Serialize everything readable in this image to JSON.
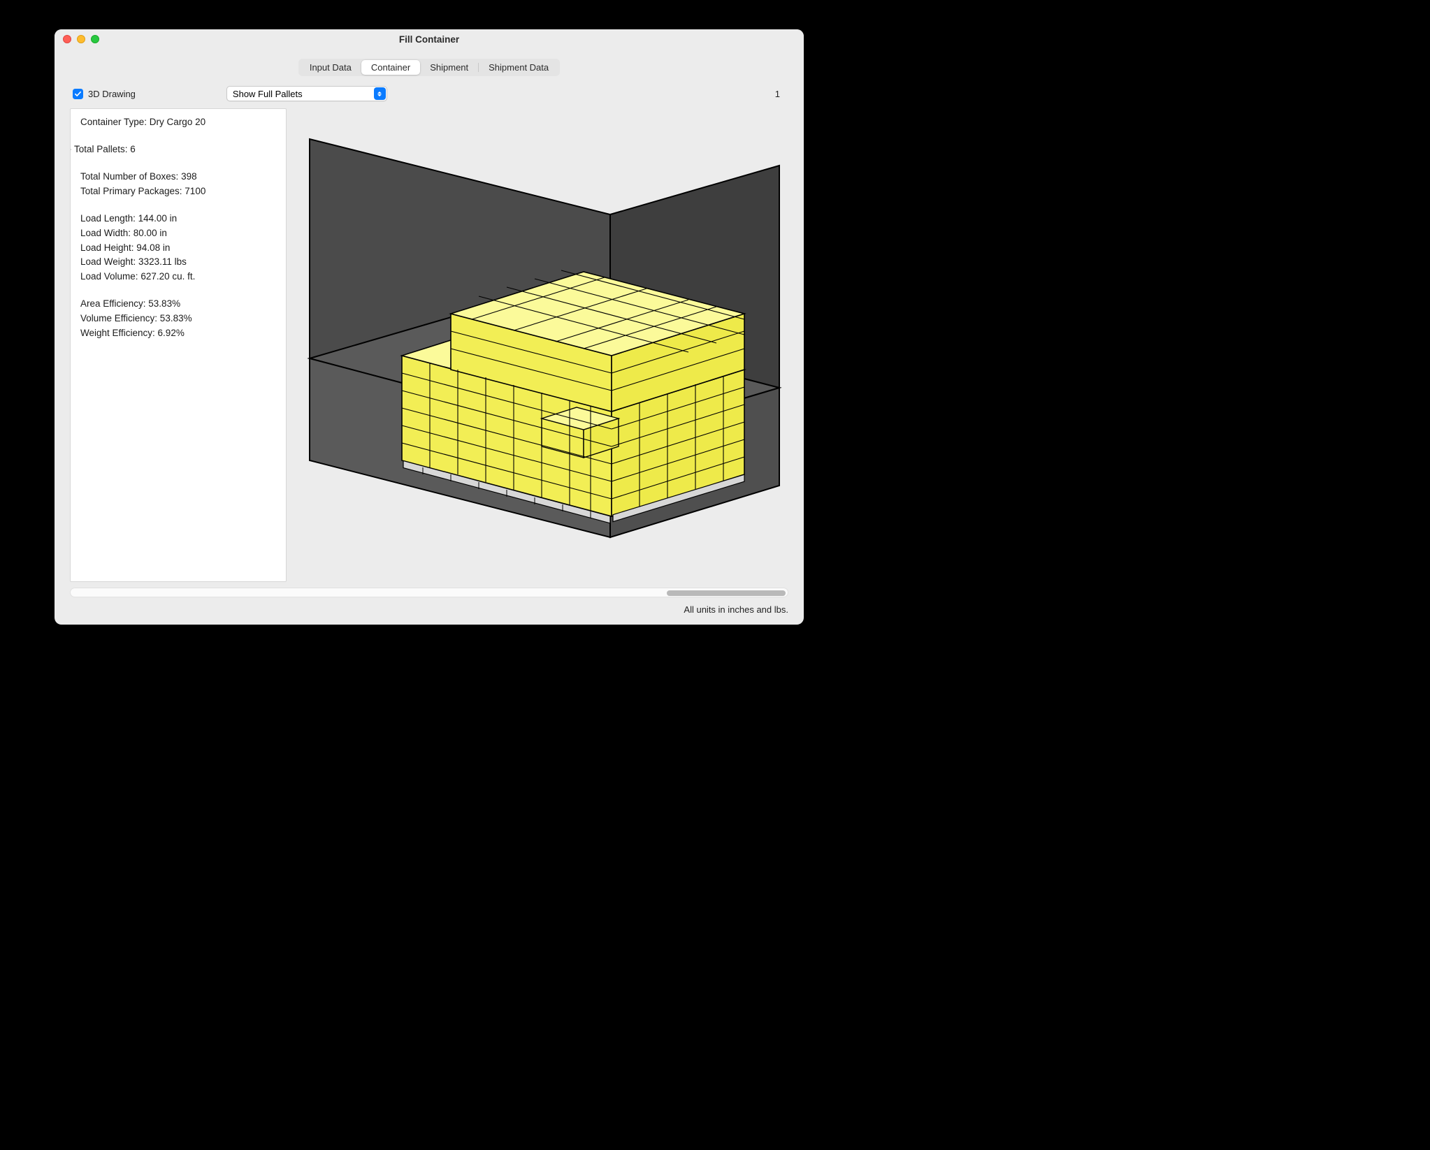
{
  "window": {
    "title": "Fill Container"
  },
  "tabs": {
    "items": [
      "Input Data",
      "Container",
      "Shipment",
      "Shipment Data"
    ],
    "selected": 1
  },
  "options": {
    "drawing3d_label": "3D Drawing",
    "drawing3d_checked": true,
    "view_selected": "Show Full Pallets",
    "count": "1"
  },
  "info": {
    "container_type": "Container Type: Dry Cargo 20",
    "total_pallets": "Total Pallets: 6",
    "total_boxes": "Total Number of Boxes: 398",
    "total_primary": "Total Primary Packages: 7100",
    "load_length": "Load Length: 144.00 in",
    "load_width": "Load Width: 80.00 in",
    "load_height": "Load Height: 94.08 in",
    "load_weight": "Load Weight: 3323.11 lbs",
    "load_volume": "Load Volume: 627.20 cu. ft.",
    "area_eff": "Area Efficiency: 53.83%",
    "vol_eff": "Volume Efficiency: 53.83%",
    "weight_eff": "Weight Efficiency: 6.92%"
  },
  "footer": {
    "units": "All units in inches and lbs."
  },
  "colors": {
    "accent": "#0a7bff",
    "box": "#f7f36a",
    "box_light": "#fbfa9a",
    "container_dark": "#4b4b4b",
    "container_floor": "#5a5a5a"
  }
}
